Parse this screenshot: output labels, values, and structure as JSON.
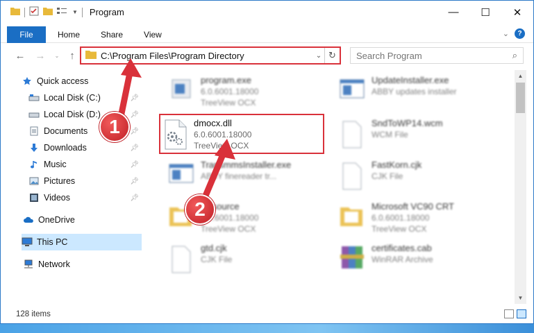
{
  "window": {
    "title": "Program",
    "minimize": "—",
    "maximize": "☐",
    "close": "✕"
  },
  "ribbon": {
    "file": "File",
    "tabs": [
      "Home",
      "Share",
      "View"
    ]
  },
  "nav": {
    "address_path": "C:\\Program Files\\Program Directory",
    "search_placeholder": "Search Program"
  },
  "sidebar": {
    "quick_access": "Quick access",
    "items": [
      {
        "label": "Local Disk (C:)",
        "icon": "drive-icon"
      },
      {
        "label": "Local Disk (D:)",
        "icon": "drive-icon"
      },
      {
        "label": "Documents",
        "icon": "documents-icon"
      },
      {
        "label": "Downloads",
        "icon": "downloads-icon"
      },
      {
        "label": "Music",
        "icon": "music-icon"
      },
      {
        "label": "Pictures",
        "icon": "pictures-icon"
      },
      {
        "label": "Videos",
        "icon": "videos-icon"
      }
    ],
    "onedrive": "OneDrive",
    "thispc": "This PC",
    "network": "Network"
  },
  "files": [
    {
      "name": "program.exe",
      "l2": "6.0.6001.18000",
      "l3": "TreeView OCX"
    },
    {
      "name": "UpdateInstaller.exe",
      "l2": "ABBY updates installer",
      "l3": ""
    },
    {
      "name": "dmocx.dll",
      "l2": "6.0.6001.18000",
      "l3": "TreeView OCX"
    },
    {
      "name": "SndToWP14.wcm",
      "l2": "WCM File",
      "l3": ""
    },
    {
      "name": "TransmmsInstaller.exe",
      "l2": "ABBY finereader tr...",
      "l3": ""
    },
    {
      "name": "FastKorn.cjk",
      "l2": "CJK File",
      "l3": ""
    },
    {
      "name": "Resource",
      "l2": "6.0.6001.18000",
      "l3": "TreeView OCX"
    },
    {
      "name": "Microsoft VC90 CRT",
      "l2": "6.0.6001.18000",
      "l3": "TreeView OCX"
    },
    {
      "name": "gtd.cjk",
      "l2": "CJK File",
      "l3": ""
    },
    {
      "name": "certificates.cab",
      "l2": "WinRAR Archive",
      "l3": ""
    }
  ],
  "status": {
    "count": "128 items"
  },
  "annotations": {
    "step1": "1",
    "step2": "2",
    "color": "#d9313a"
  }
}
